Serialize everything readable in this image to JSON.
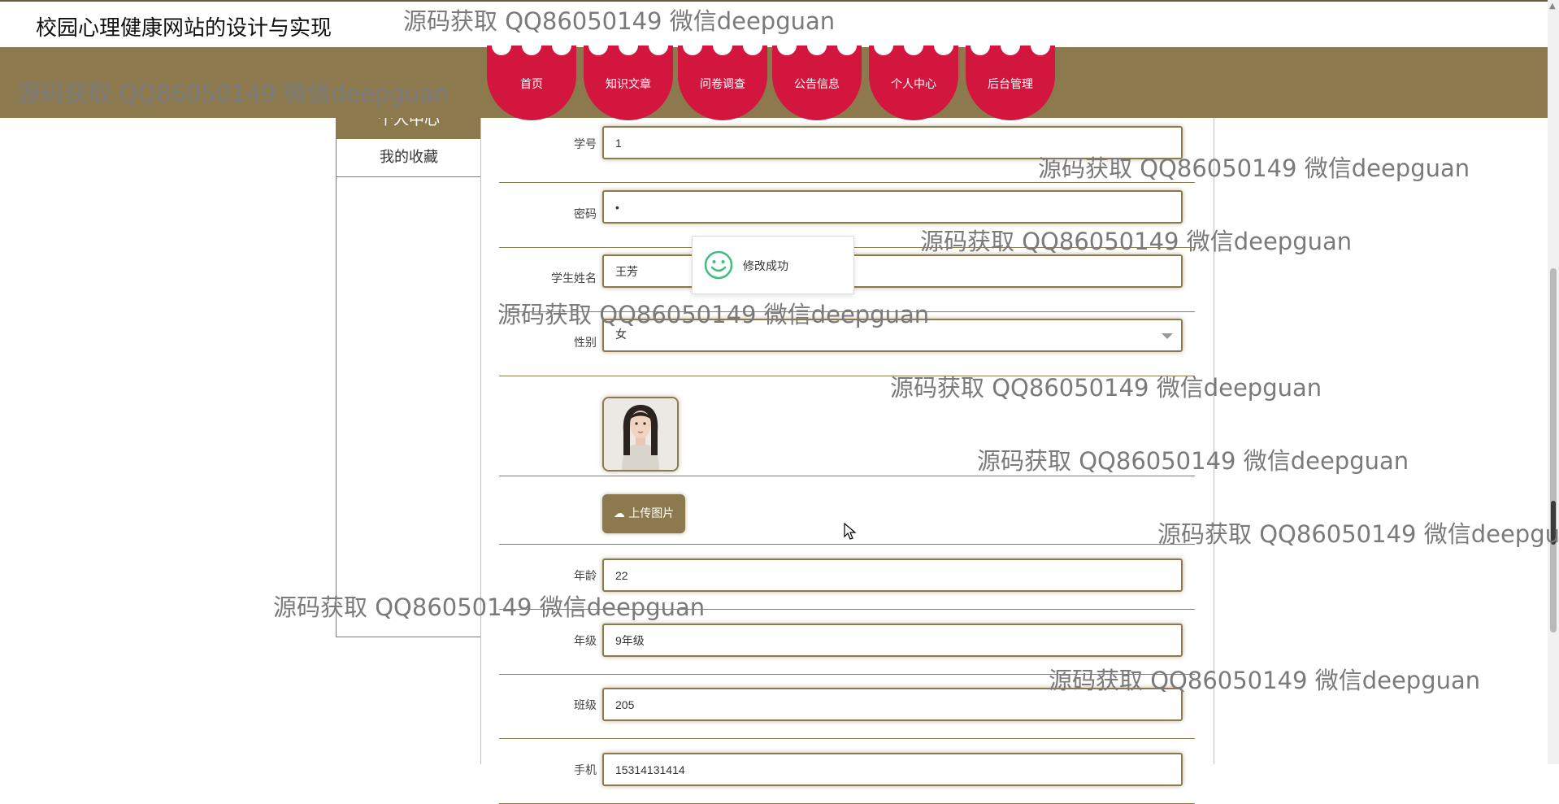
{
  "site": {
    "title": "校园心理健康网站的设计与实现"
  },
  "nav": {
    "items": [
      {
        "label": "首页"
      },
      {
        "label": "知识文章"
      },
      {
        "label": "问卷调查"
      },
      {
        "label": "公告信息"
      },
      {
        "label": "个人中心"
      },
      {
        "label": "后台管理"
      }
    ]
  },
  "sidebar": {
    "heading": "个人中心",
    "items": [
      {
        "label": "我的收藏"
      }
    ]
  },
  "form": {
    "student_id": {
      "label": "学号",
      "value": "1"
    },
    "password": {
      "label": "密码",
      "value": "•"
    },
    "name": {
      "label": "学生姓名",
      "value": "王芳"
    },
    "gender": {
      "label": "性别",
      "value": "女"
    },
    "upload": {
      "label": "上传图片"
    },
    "age": {
      "label": "年龄",
      "value": "22"
    },
    "grade": {
      "label": "年级",
      "value": "9年级"
    },
    "class": {
      "label": "班级",
      "value": "205"
    },
    "phone": {
      "label": "手机",
      "value": "15314131414"
    }
  },
  "toast": {
    "message": "修改成功"
  },
  "watermark": {
    "text": "源码获取 QQ86050149 微信deepguan"
  },
  "colors": {
    "accent": "#8c7a4e",
    "nav_item": "#d2163d",
    "toast_icon": "#3dbf7f"
  },
  "icons": {
    "upload": "cloud-upload-icon",
    "toast": "smile-icon"
  }
}
